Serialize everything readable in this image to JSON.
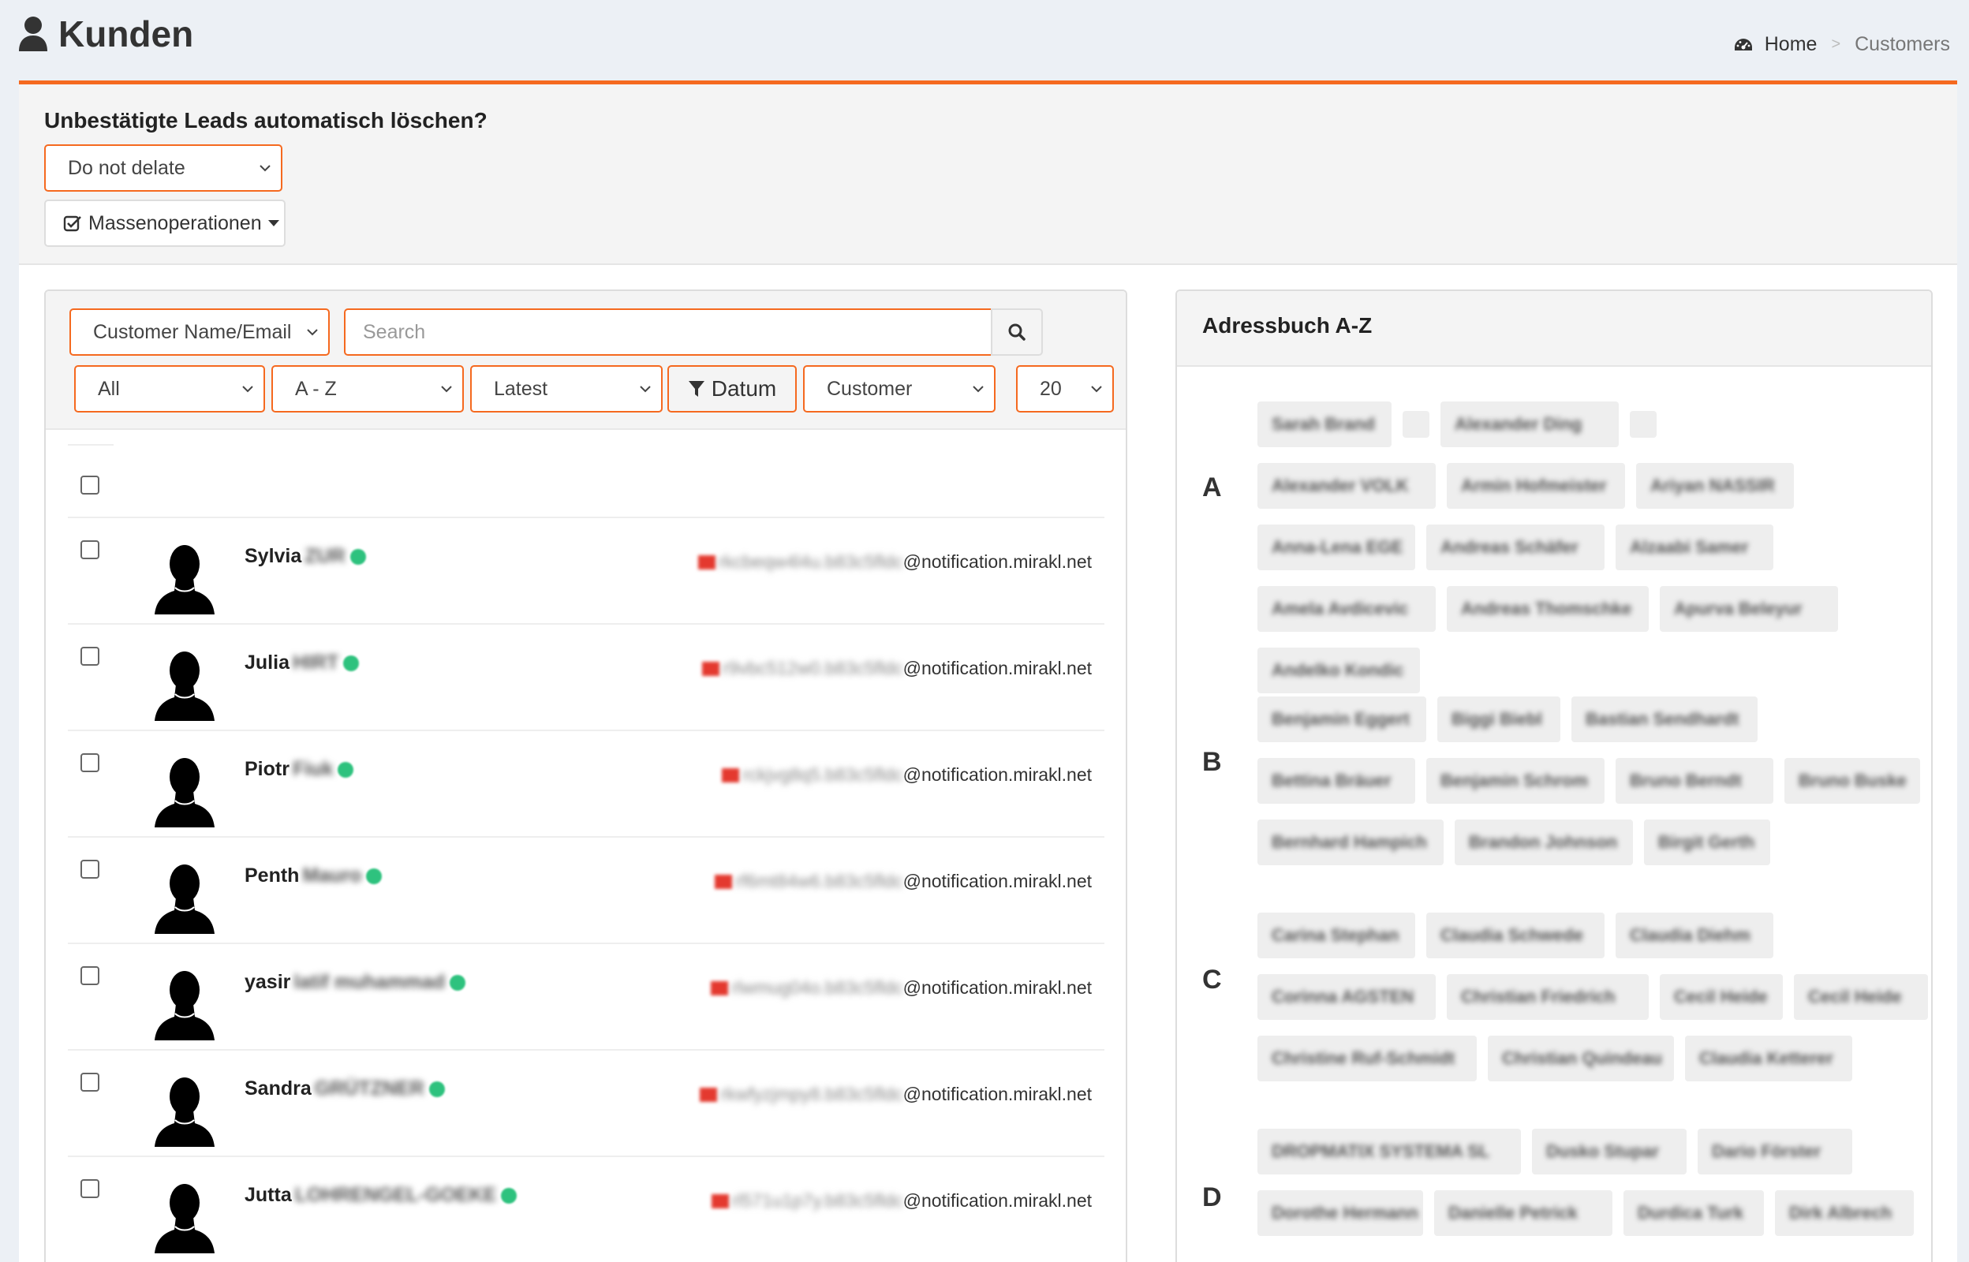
{
  "header": {
    "title": "Kunden",
    "breadcrumb": {
      "home": "Home",
      "separator": ">",
      "current": "Customers"
    }
  },
  "settings": {
    "question": "Unbestätigte Leads automatisch löschen?",
    "delete_select_value": "Do not delate",
    "mass_button": "Massenoperationen"
  },
  "filters": {
    "search_field": "Customer Name/Email",
    "search_placeholder": "Search",
    "status": "All",
    "sort": "A - Z",
    "order": "Latest",
    "date_button": "Datum",
    "type": "Customer",
    "per_page": "20"
  },
  "customers": [
    {
      "first": "Sylvia",
      "last": "ZUR",
      "email_local": "rkcbeqw4l4u.b83c5fldc",
      "email_domain": "@notification.mirakl.net"
    },
    {
      "first": "Julia",
      "last": "HIRT",
      "email_local": "r9vbc512w0.b83c5fldc",
      "email_domain": "@notification.mirakl.net"
    },
    {
      "first": "Piotr",
      "last": "Fiuk",
      "email_local": "rckjvg8q5.b83c5fldc",
      "email_domain": "@notification.mirakl.net"
    },
    {
      "first": "Penth",
      "last": "Mauro",
      "email_local": "rf6mt84w6.b83c5fldc",
      "email_domain": "@notification.mirakl.net"
    },
    {
      "first": "yasir",
      "last": "latif muhammad",
      "email_local": "rlwmug04o.b83c5fldc",
      "email_domain": "@notification.mirakl.net"
    },
    {
      "first": "Sandra",
      "last": "GRÜTZNER",
      "email_local": "rkwfyzjmpy8.b83c5fldc",
      "email_domain": "@notification.mirakl.net"
    },
    {
      "first": "Jutta",
      "last": "LOHRENGEL-GOEKE",
      "email_local": "rl571u1p7y.b83c5fldc",
      "email_domain": "@notification.mirakl.net"
    }
  ],
  "address_book": {
    "title": "Adressbuch A-Z",
    "letters": [
      "A",
      "B",
      "C",
      "D"
    ],
    "names": {
      "a": [
        "Sarah Brand",
        "Alexander Ding",
        "Alexander VOLK",
        "Armin Hofmeister",
        "Ariyan NASSIR",
        "Anna-Lena EGE",
        "Andreas Schäfer",
        "Alzaabi Samer",
        "Amela Avdicevic",
        "Andreas Thomschke",
        "Apurva Beleyur",
        "Andelko Kondic"
      ],
      "b": [
        "Benjamin Eggert",
        "Biggi Biebl",
        "Bastian Sendhardt",
        "Bettina Bräuer",
        "Benjamin Schrom",
        "Bruno Berndt",
        "Bruno Buske",
        "Bernhard Hampich",
        "Brandon Johnson",
        "Birgit Gerth"
      ],
      "c": [
        "Carina Stephan",
        "Claudia Schwede",
        "Claudia Diehm",
        "Corinna AGSTEN",
        "Christian Friedrich",
        "Cecil Heide",
        "Cecil Heide",
        "Christine Ruf-Schmidt",
        "Christian Quindeau",
        "Claudia Ketterer"
      ],
      "d": [
        "DROPMATIX SYSTEMA SL",
        "Dusko Stupar",
        "Dario Förster",
        "Dorothe Hermann",
        "Danielle Petrick",
        "Durdica Turk",
        "Dirk Albrech"
      ]
    }
  }
}
